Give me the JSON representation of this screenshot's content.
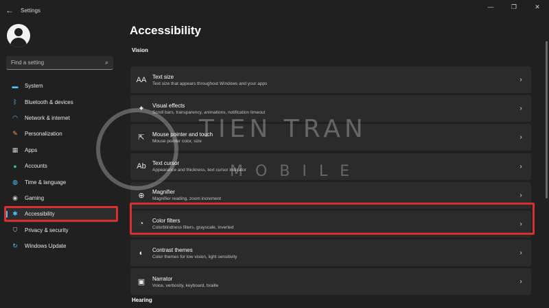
{
  "window": {
    "title": "Settings",
    "back": "←",
    "controls": [
      "—",
      "❐",
      "✕"
    ]
  },
  "search": {
    "placeholder": "Find a setting"
  },
  "nav": [
    {
      "label": "System",
      "icon": "monitor-icon",
      "color": "#4cc2ff"
    },
    {
      "label": "Bluetooth & devices",
      "icon": "bluetooth-icon",
      "color": "#4cc2ff"
    },
    {
      "label": "Network & internet",
      "icon": "wifi-icon",
      "color": "#4cc2ff"
    },
    {
      "label": "Personalization",
      "icon": "brush-icon",
      "color": "#f7a35c"
    },
    {
      "label": "Apps",
      "icon": "apps-icon",
      "color": "#c9c9c9"
    },
    {
      "label": "Accounts",
      "icon": "person-icon",
      "color": "#3fc07f"
    },
    {
      "label": "Time & language",
      "icon": "globe-icon",
      "color": "#4cc2ff"
    },
    {
      "label": "Gaming",
      "icon": "gamepad-icon",
      "color": "#c9c9c9"
    },
    {
      "label": "Accessibility",
      "icon": "accessibility-icon",
      "color": "#4cc2ff"
    },
    {
      "label": "Privacy & security",
      "icon": "shield-icon",
      "color": "#c9c9c9"
    },
    {
      "label": "Windows Update",
      "icon": "update-icon",
      "color": "#4cc2ff"
    }
  ],
  "active_nav": "Accessibility",
  "main": {
    "title": "Accessibility",
    "sections": [
      {
        "label": "Vision"
      },
      {
        "label": "Hearing"
      }
    ],
    "cards": [
      {
        "title": "Text size",
        "subtitle": "Text size that appears throughout Windows and your apps",
        "icon": "text-size-icon",
        "glyph": "AA"
      },
      {
        "title": "Visual effects",
        "subtitle": "Scroll bars, transparency, animations, notification timeout",
        "icon": "sparkle-icon",
        "glyph": "✦"
      },
      {
        "title": "Mouse pointer and touch",
        "subtitle": "Mouse pointer color, size",
        "icon": "pointer-icon",
        "glyph": "⇱"
      },
      {
        "title": "Text cursor",
        "subtitle": "Appearance and thickness, text cursor indicator",
        "icon": "text-cursor-icon",
        "glyph": "Ab"
      },
      {
        "title": "Magnifier",
        "subtitle": "Magnifier reading, zoom increment",
        "icon": "magnifier-icon",
        "glyph": "⊕"
      },
      {
        "title": "Color filters",
        "subtitle": "Colorblindness filters, grayscale, inverted",
        "icon": "color-filter-icon",
        "glyph": "◔"
      },
      {
        "title": "Contrast themes",
        "subtitle": "Color themes for low vision, light sensitivity",
        "icon": "contrast-icon",
        "glyph": "◐"
      },
      {
        "title": "Narrator",
        "subtitle": "Voice, verbosity, keyboard, braille",
        "icon": "narrator-icon",
        "glyph": "▣"
      }
    ],
    "chevron": "›"
  },
  "watermark": {
    "line1": "TIEN TRAN",
    "line2": "MOBILE"
  },
  "colors": {
    "background": "#202020",
    "card": "#2b2b2b",
    "accent": "#4cc2ff",
    "highlight": "#d9302f"
  }
}
